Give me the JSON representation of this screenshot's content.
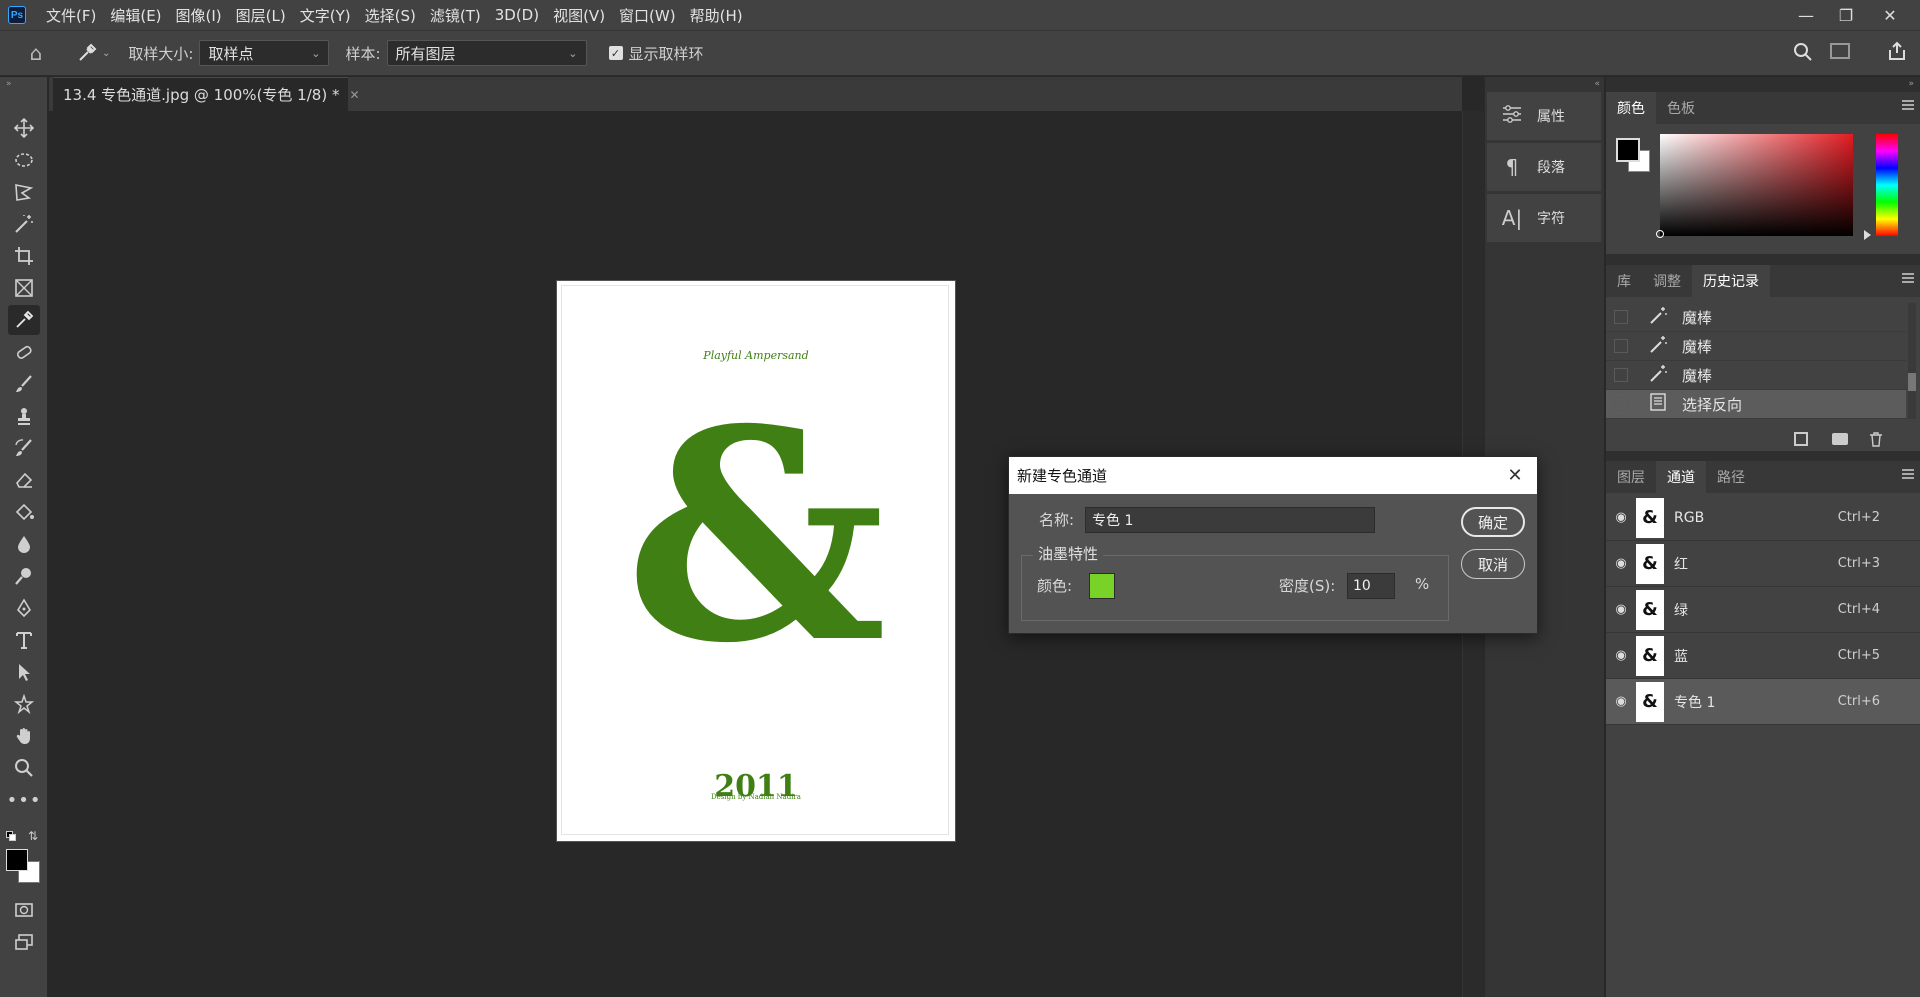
{
  "app": {
    "logo": "Ps"
  },
  "menu": [
    "文件(F)",
    "编辑(E)",
    "图像(I)",
    "图层(L)",
    "文字(Y)",
    "选择(S)",
    "滤镜(T)",
    "3D(D)",
    "视图(V)",
    "窗口(W)",
    "帮助(H)"
  ],
  "options": {
    "sample_size_label": "取样大小:",
    "sample_size_value": "取样点",
    "sample_label": "样本:",
    "sample_value": "所有图层",
    "show_ring_label": "显示取样环"
  },
  "document": {
    "tab_title": "13.4 专色通道.jpg @ 100%(专色 1/8) *",
    "poster_caption": "Playful Ampersand",
    "poster_year": "2011",
    "poster_credit": "Design by Nadiah Nadira",
    "glyph": "&",
    "glyph_color": "#3f7f14"
  },
  "mid_panel": {
    "items": [
      "属性",
      "段落",
      "字符"
    ]
  },
  "color_panel": {
    "tabs": [
      "颜色",
      "色板"
    ],
    "hue": "#e31c22"
  },
  "history_panel": {
    "tabs": [
      "库",
      "调整",
      "历史记录"
    ],
    "items": [
      "魔棒",
      "魔棒",
      "魔棒",
      "选择反向"
    ]
  },
  "channels_panel": {
    "tabs": [
      "图层",
      "通道",
      "路径"
    ],
    "rows": [
      {
        "name": "RGB",
        "shortcut": "Ctrl+2"
      },
      {
        "name": "红",
        "shortcut": "Ctrl+3"
      },
      {
        "name": "绿",
        "shortcut": "Ctrl+4"
      },
      {
        "name": "蓝",
        "shortcut": "Ctrl+5"
      },
      {
        "name": "专色 1",
        "shortcut": "Ctrl+6"
      }
    ]
  },
  "dialog": {
    "title": "新建专色通道",
    "name_label": "名称:",
    "name_value": "专色 1",
    "group_label": "油墨特性",
    "color_label": "颜色:",
    "ink_color": "#78d228",
    "solidity_label": "密度(S):",
    "solidity_value": "10",
    "percent": "%",
    "ok": "确定",
    "cancel": "取消"
  }
}
